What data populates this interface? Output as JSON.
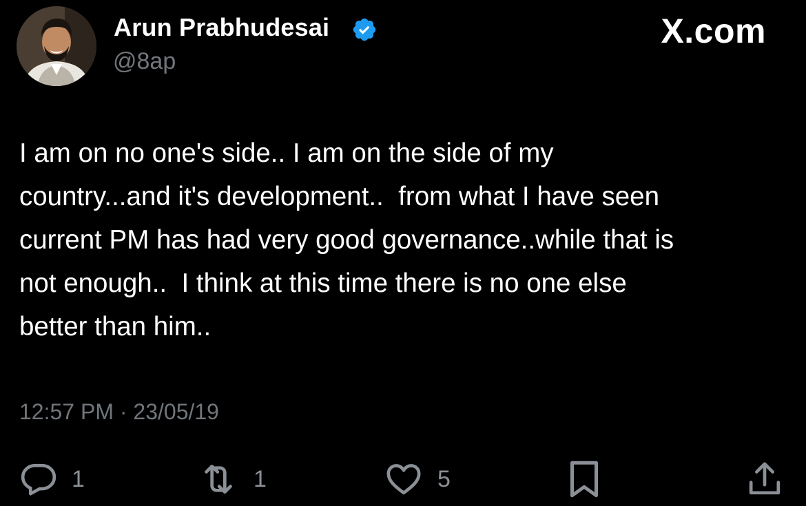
{
  "author": {
    "display_name": "Arun Prabhudesai",
    "handle": "@8ap",
    "verified": true,
    "verified_color": "#1d9bf0"
  },
  "brand": "X.com",
  "tweet": {
    "text": "I am on no one's side.. I am on the side of my\ncountry...and it's development..  from what I have seen\ncurrent PM has had very good governance..while that is\nnot enough..  I think at this time there is no one else\nbetter than him..",
    "timestamp": "12:57 PM · 23/05/19"
  },
  "actions": {
    "reply": {
      "icon": "reply-icon",
      "count": "1"
    },
    "retweet": {
      "icon": "retweet-icon",
      "count": "1"
    },
    "like": {
      "icon": "heart-icon",
      "count": "5"
    },
    "bookmark": {
      "icon": "bookmark-icon"
    },
    "share": {
      "icon": "share-icon"
    }
  },
  "colors": {
    "background": "#000000",
    "text_primary": "#ffffff",
    "text_secondary": "#71767b",
    "accent": "#1d9bf0"
  }
}
